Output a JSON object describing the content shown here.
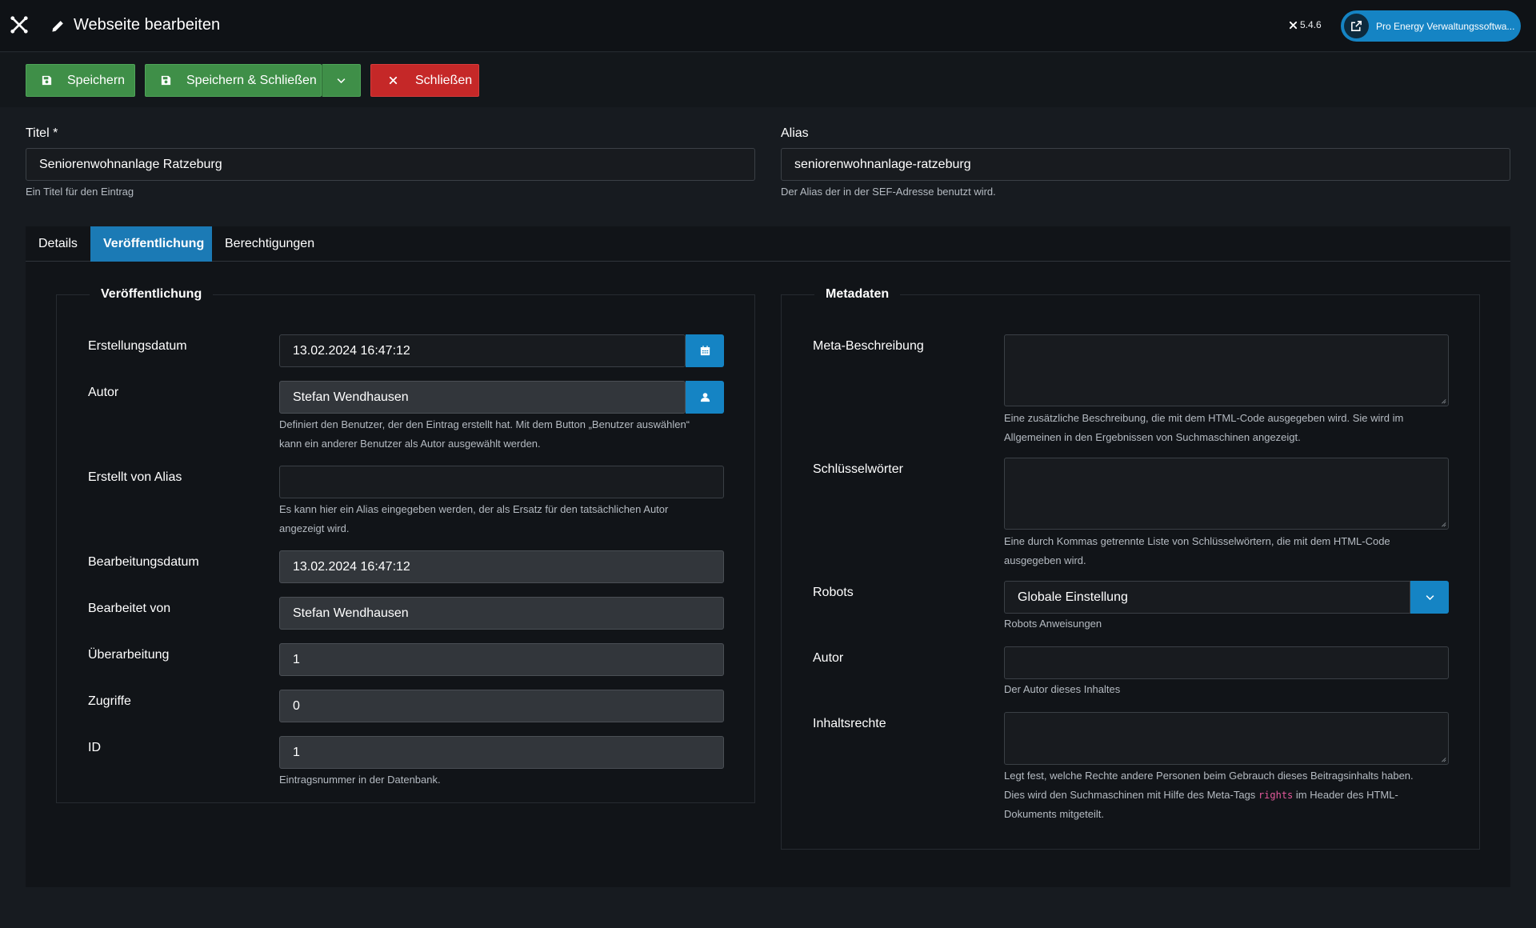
{
  "header": {
    "title": "Webseite bearbeiten",
    "version": "5.4.6",
    "site_button": "Pro Energy Verwaltungssoftwa..."
  },
  "toolbar": {
    "save": "Speichern",
    "save_close": "Speichern & Schließen",
    "close": "Schließen"
  },
  "title_field": {
    "label": "Titel *",
    "value": "Seniorenwohnanlage Ratzeburg",
    "hint": "Ein Titel für den Eintrag"
  },
  "alias_field": {
    "label": "Alias",
    "value": "seniorenwohnanlage-ratzeburg",
    "hint": "Der Alias der in der SEF-Adresse benutzt wird."
  },
  "tabs": [
    {
      "label": "Details"
    },
    {
      "label": "Veröffentlichung"
    },
    {
      "label": "Berechtigungen"
    }
  ],
  "publishing": {
    "legend": "Veröffentlichung",
    "created_label": "Erstellungsdatum",
    "created_value": "13.02.2024 16:47:12",
    "author_label": "Autor",
    "author_value": "Stefan Wendhausen",
    "author_hint_1": "Definiert den Benutzer, der den Eintrag erstellt hat. Mit dem Button „Benutzer auswählen“",
    "author_hint_2": "kann ein anderer Benutzer als Autor ausgewählt werden.",
    "alias_label": "Erstellt von Alias",
    "alias_value": "",
    "alias_hint_1": "Es kann hier ein Alias eingegeben werden, der als Ersatz für den tatsächlichen Autor",
    "alias_hint_2": "angezeigt wird.",
    "modified_label": "Bearbeitungsdatum",
    "modified_value": "13.02.2024 16:47:12",
    "modified_by_label": "Bearbeitet von",
    "modified_by_value": "Stefan Wendhausen",
    "revision_label": "Überarbeitung",
    "revision_value": "1",
    "hits_label": "Zugriffe",
    "hits_value": "0",
    "id_label": "ID",
    "id_value": "1",
    "id_hint": "Eintragsnummer in der Datenbank."
  },
  "metadata": {
    "legend": "Metadaten",
    "desc_label": "Meta-Beschreibung",
    "desc_hint_1": "Eine zusätzliche Beschreibung, die mit dem HTML-Code ausgegeben wird. Sie wird im",
    "desc_hint_2": "Allgemeinen in den Ergebnissen von Suchmaschinen angezeigt.",
    "keywords_label": "Schlüsselwörter",
    "keywords_hint_1": "Eine durch Kommas getrennte Liste von Schlüsselwörtern, die mit dem HTML-Code",
    "keywords_hint_2": "ausgegeben wird.",
    "robots_label": "Robots",
    "robots_value": "Globale Einstellung",
    "robots_hint": "Robots Anweisungen",
    "author_label": "Autor",
    "author_value": "",
    "author_hint": "Der Autor dieses Inhaltes",
    "rights_label": "Inhaltsrechte",
    "rights_hint_1": "Legt fest, welche Rechte andere Personen beim Gebrauch dieses Beitragsinhalts haben.",
    "rights_hint_2a": "Dies wird den Suchmaschinen mit Hilfe des Meta-Tags",
    "rights_hint_code": "rights",
    "rights_hint_2b": "im Header des HTML-",
    "rights_hint_3": "Dokuments mitgeteilt."
  },
  "colors": {
    "accent": "#1584c4",
    "save_green": "#3f8f48",
    "close_red": "#c52828",
    "background": "#171b20"
  }
}
